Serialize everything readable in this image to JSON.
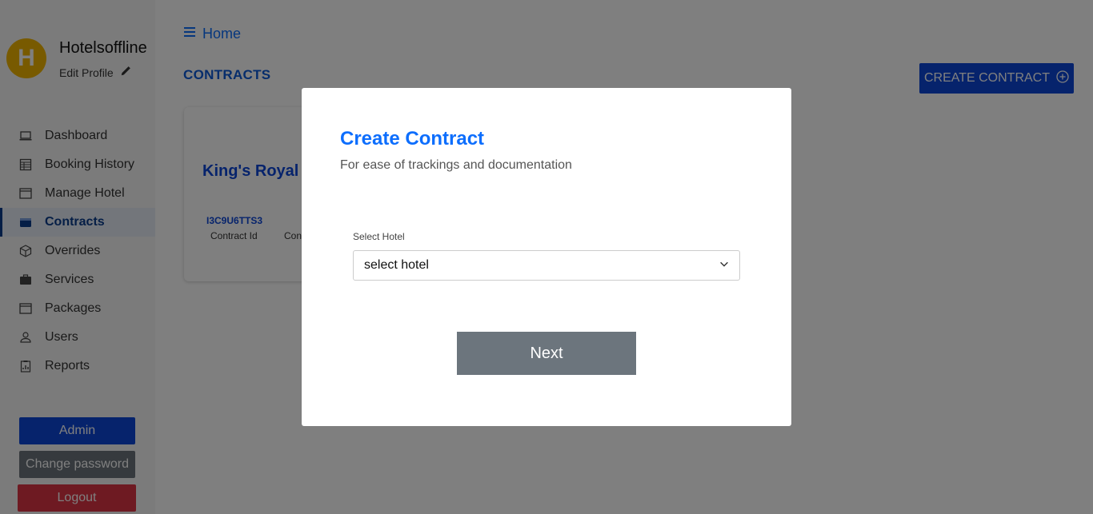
{
  "profile": {
    "initial": "H",
    "name": "Hotelsoffline",
    "edit_label": "Edit Profile"
  },
  "nav": [
    {
      "label": "Dashboard",
      "icon": "laptop-icon"
    },
    {
      "label": "Booking History",
      "icon": "table-icon"
    },
    {
      "label": "Manage Hotel",
      "icon": "window-icon"
    },
    {
      "label": "Contracts",
      "icon": "wallet-icon",
      "active": true
    },
    {
      "label": "Overrides",
      "icon": "box-icon"
    },
    {
      "label": "Services",
      "icon": "briefcase-icon"
    },
    {
      "label": "Packages",
      "icon": "window-icon"
    },
    {
      "label": "Users",
      "icon": "person-icon"
    },
    {
      "label": "Reports",
      "icon": "clipboard-data-icon"
    }
  ],
  "sidebar_buttons": {
    "admin": "Admin",
    "change_password": "Change password",
    "logout": "Logout"
  },
  "breadcrumb": {
    "label": "Home"
  },
  "page": {
    "title": "CONTRACTS",
    "create_button": "CREATE CONTRACT"
  },
  "card": {
    "hotel_name": "King's Royal",
    "contract_id": "I3C9U6TTS3",
    "contract_id_label": "Contract Id",
    "second_label": "Con"
  },
  "modal": {
    "title": "Create Contract",
    "subtitle": "For ease of trackings and documentation",
    "select_label": "Select Hotel",
    "select_value": "select hotel",
    "next_button": "Next"
  },
  "colors": {
    "primary": "#0d47d9",
    "link": "#0d6efd",
    "secondary": "#6c757d",
    "danger": "#dc3545",
    "avatar": "#f0b400"
  }
}
